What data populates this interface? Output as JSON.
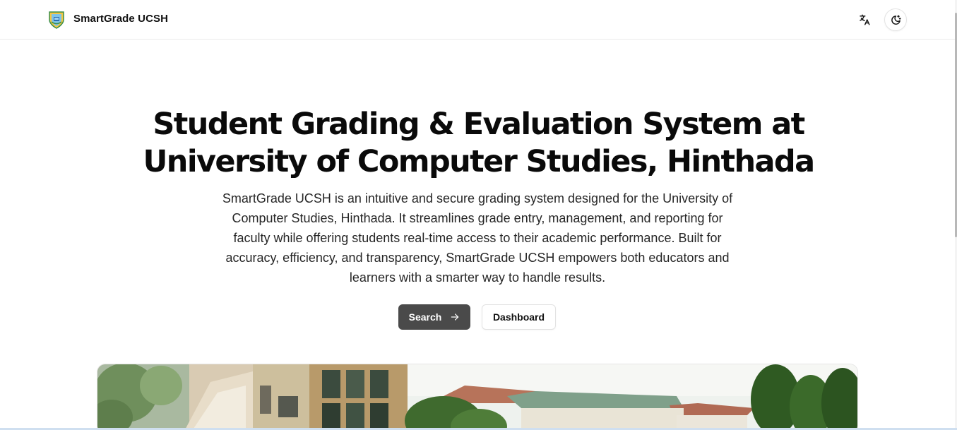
{
  "header": {
    "brand": "SmartGrade UCSH",
    "logo_icon": "university-crest-icon",
    "translate_icon": "translate-icon",
    "theme_icon": "moon-stars-icon"
  },
  "hero": {
    "title_line1": "Student Grading & Evaluation System at",
    "title_line2": "University of Computer Studies, Hinthada",
    "description": "SmartGrade UCSH is an intuitive and secure grading system designed for the University of Computer Studies, Hinthada. It streamlines grade entry, management, and reporting for faculty while offering students real-time access to their academic performance. Built for accuracy, efficiency, and transparency, SmartGrade UCSH empowers both educators and learners with a smarter way to handle results."
  },
  "actions": {
    "search_label": "Search",
    "search_icon": "arrow-right-icon",
    "dashboard_label": "Dashboard"
  },
  "colors": {
    "primary_button": "#4a4a4a",
    "text": "#0a0a0a",
    "border": "#e2e2e2"
  }
}
